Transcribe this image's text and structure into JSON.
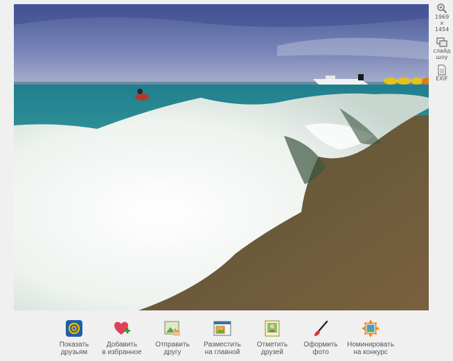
{
  "photo": {
    "alt_colors": {
      "sky": "#5a6aa8",
      "sea": "#2e8a9a",
      "foam": "#f4f7f4",
      "sand": "#6a5a3a"
    }
  },
  "side_tools": [
    {
      "icon": "zoom-icon",
      "line1": "1969",
      "line2": "×",
      "line3": "1454"
    },
    {
      "icon": "slideshow-icon",
      "line1": "слайд",
      "line2": "шоу"
    },
    {
      "icon": "exif-icon",
      "line1": "EXIF"
    }
  ],
  "actions": [
    {
      "icon": "mail-at-icon",
      "line1": "Показать",
      "line2": "друзьям"
    },
    {
      "icon": "heart-plus-icon",
      "line1": "Добавить",
      "line2": "в избранное"
    },
    {
      "icon": "send-photo-icon",
      "line1": "Отправить",
      "line2": "другу"
    },
    {
      "icon": "place-on-main-icon",
      "line1": "Разместить",
      "line2": "на главной"
    },
    {
      "icon": "tag-friends-icon",
      "line1": "Отметить",
      "line2": "друзей"
    },
    {
      "icon": "brush-icon",
      "line1": "Оформить",
      "line2": "фото"
    },
    {
      "icon": "contest-badge-icon",
      "line1": "Номинировать",
      "line2": "на конкурс"
    }
  ]
}
